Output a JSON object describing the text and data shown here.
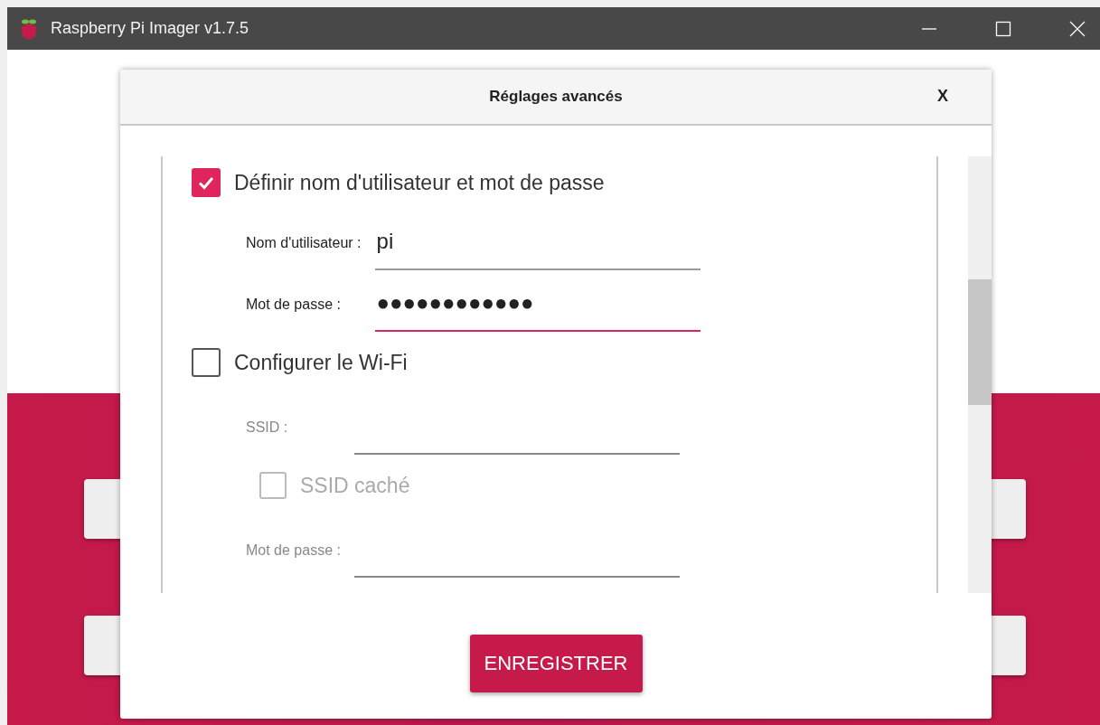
{
  "window": {
    "title": "Raspberry Pi Imager v1.7.5"
  },
  "dialog": {
    "title": "Réglages avancés",
    "close": "X",
    "sections": [
      {
        "label": "Définir nom d'utilisateur et mot de passe",
        "checked": true,
        "items": [
          {
            "kind": "field",
            "label": "Nom d'utilisateur :",
            "value": "pi",
            "focused": false,
            "disabled": false
          },
          {
            "kind": "field",
            "label": "Mot de passe :",
            "value": "●●●●●●●●●●●●",
            "focused": true,
            "disabled": false
          }
        ]
      },
      {
        "label": "Configurer le Wi-Fi",
        "checked": false,
        "items": [
          {
            "kind": "field",
            "label": "SSID :",
            "focused": false,
            "disabled": true
          },
          {
            "kind": "checkbox",
            "label": "SSID caché",
            "checked": false,
            "disabled": true
          },
          {
            "kind": "field",
            "label": "Mot de passe :",
            "focused": false,
            "disabled": true
          }
        ]
      }
    ],
    "save_button": "ENREGISTRER"
  }
}
